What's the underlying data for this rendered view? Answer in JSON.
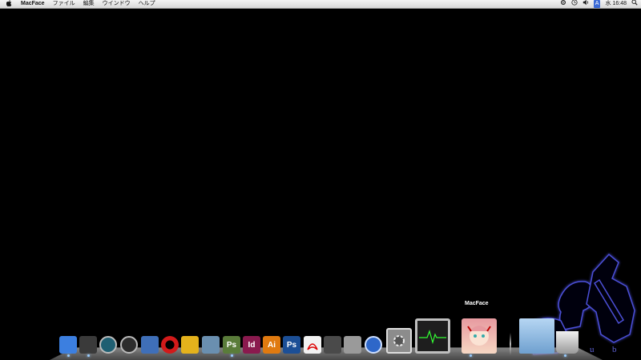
{
  "menubar": {
    "apple": "",
    "app_name": "MacFace",
    "menus": [
      "ファイル",
      "編集",
      "ウインドウ",
      "ヘルプ"
    ],
    "status": {
      "input_badge": "A",
      "day": "水",
      "time": "16:48"
    }
  },
  "dock": {
    "hover_label": "MacFace",
    "items": [
      {
        "name": "finder-icon",
        "color": "#3c7fe0"
      },
      {
        "name": "dashboard-icon",
        "color": "#3a3a3a"
      },
      {
        "name": "time-machine-icon",
        "color": "#1f5f72"
      },
      {
        "name": "speedometer-icon",
        "color": "#2d2d2d"
      },
      {
        "name": "preview-icon",
        "color": "#3f6fb8"
      },
      {
        "name": "opera-icon",
        "color": "#d21a1a"
      },
      {
        "name": "cyberduck-icon",
        "color": "#e4b21c"
      },
      {
        "name": "applescript-icon",
        "color": "#6a8fb0"
      },
      {
        "name": "bridge-ps-icon",
        "color": "#5a7c3a",
        "text": "Ps"
      },
      {
        "name": "indesign-icon",
        "color": "#8a1a4e",
        "text": "Id"
      },
      {
        "name": "illustrator-icon",
        "color": "#e07a10",
        "text": "Ai"
      },
      {
        "name": "photoshop-icon",
        "color": "#1c4f96",
        "text": "Ps"
      },
      {
        "name": "acrobat-reader-icon",
        "color": "#f2f2f2"
      },
      {
        "name": "acrobat-icon",
        "color": "#4a4a4a"
      },
      {
        "name": "script-editor-icon",
        "color": "#9a9a9a"
      },
      {
        "name": "home-icon",
        "color": "#2e67c9"
      },
      {
        "name": "system-preferences-icon",
        "color": "#8c8c8c"
      },
      {
        "name": "activity-monitor-icon",
        "color": "#1e1e1e"
      },
      {
        "name": "macface-icon",
        "color": "#f3c7a7"
      },
      {
        "name": "folder-icon",
        "color": "#8ab6de"
      },
      {
        "name": "trash-icon",
        "color": "#cfcfcf"
      }
    ]
  }
}
